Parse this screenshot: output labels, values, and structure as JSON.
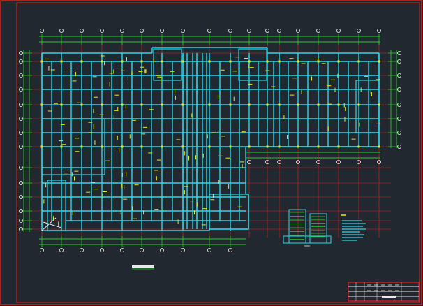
{
  "drawing": {
    "background": "#212830",
    "colors": {
      "frame": "#e0201c",
      "axis": "#d82020",
      "beam": "#28d8e8",
      "dim": "#20d020",
      "tick": "#e8e820",
      "white": "#e8e8e8",
      "magenta": "#e040e0"
    }
  },
  "title_block": {
    "rows": 4
  },
  "legend": {
    "lines": 8
  }
}
